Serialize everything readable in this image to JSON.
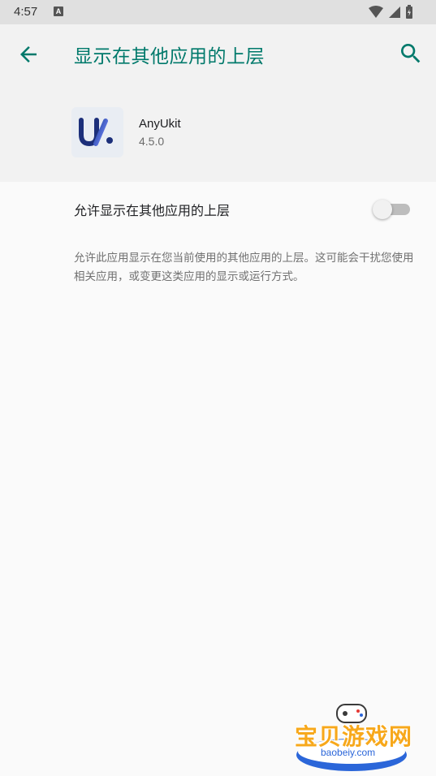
{
  "status_bar": {
    "time": "4:57",
    "notification_icon": "A"
  },
  "app_bar": {
    "title": "显示在其他应用的上层"
  },
  "app_info": {
    "name": "AnyUkit",
    "version": "4.5.0"
  },
  "permission": {
    "label": "允许显示在其他应用的上层",
    "enabled": false,
    "description": "允许此应用显示在您当前使用的其他应用的上层。这可能会干扰您使用相关应用，或变更这类应用的显示或运行方式。"
  },
  "watermark": {
    "text": "宝贝游戏网",
    "url": "baobeiy.com"
  },
  "colors": {
    "accent": "#00796b",
    "toggle_off": "#bdbdbd",
    "header_bg": "#f2f2f2"
  }
}
